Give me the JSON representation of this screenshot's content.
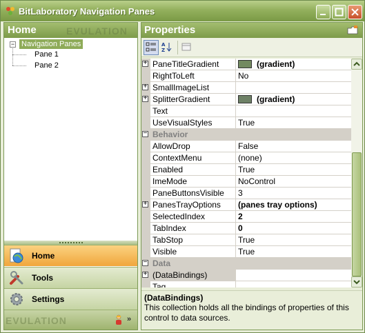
{
  "window": {
    "title": "BitLaboratory Navigation Panes",
    "controls": [
      "minimize",
      "maximize",
      "close"
    ]
  },
  "left_panel": {
    "header_title": "Home",
    "watermark": "EVULATION",
    "tree": {
      "root": "Navigation Panes",
      "children": [
        "Pane 1",
        "Pane 2"
      ]
    },
    "panes": [
      {
        "label": "Home",
        "icon": "home-globe-icon",
        "active": true
      },
      {
        "label": "Tools",
        "icon": "tools-icon",
        "active": false
      },
      {
        "label": "Settings",
        "icon": "settings-gear-icon",
        "active": false
      }
    ],
    "tray": {
      "watermark": "EVULATION",
      "chevron": "»"
    }
  },
  "properties": {
    "header_title": "Properties",
    "rows": [
      {
        "type": "prop",
        "expander": "+",
        "name": "PaneTitleGradient",
        "value": "(gradient)",
        "bold": true,
        "swatch": "#738a60"
      },
      {
        "type": "prop",
        "expander": "",
        "name": "RightToLeft",
        "value": "No",
        "bold": false
      },
      {
        "type": "prop",
        "expander": "+",
        "name": "SmallImageList",
        "value": "",
        "bold": false
      },
      {
        "type": "prop",
        "expander": "+",
        "name": "SplitterGradient",
        "value": "(gradient)",
        "bold": true,
        "swatch": "#6e8166"
      },
      {
        "type": "prop",
        "expander": "",
        "name": "Text",
        "value": "",
        "bold": false
      },
      {
        "type": "prop",
        "expander": "",
        "name": "UseVisualStyles",
        "value": "True",
        "bold": false
      },
      {
        "type": "cat",
        "expander": "−",
        "name": "Behavior"
      },
      {
        "type": "prop",
        "expander": "",
        "name": "AllowDrop",
        "value": "False",
        "bold": false
      },
      {
        "type": "prop",
        "expander": "",
        "name": "ContextMenu",
        "value": "(none)",
        "bold": false
      },
      {
        "type": "prop",
        "expander": "",
        "name": "Enabled",
        "value": "True",
        "bold": false
      },
      {
        "type": "prop",
        "expander": "",
        "name": "ImeMode",
        "value": "NoControl",
        "bold": false
      },
      {
        "type": "prop",
        "expander": "",
        "name": "PaneButtonsVisible",
        "value": "3",
        "bold": false
      },
      {
        "type": "prop",
        "expander": "+",
        "name": "PanesTrayOptions",
        "value": "(panes tray options)",
        "bold": true
      },
      {
        "type": "prop",
        "expander": "",
        "name": "SelectedIndex",
        "value": "2",
        "bold": true
      },
      {
        "type": "prop",
        "expander": "",
        "name": "TabIndex",
        "value": "0",
        "bold": true
      },
      {
        "type": "prop",
        "expander": "",
        "name": "TabStop",
        "value": "True",
        "bold": false
      },
      {
        "type": "prop",
        "expander": "",
        "name": "Visible",
        "value": "True",
        "bold": false
      },
      {
        "type": "cat",
        "expander": "−",
        "name": "Data"
      },
      {
        "type": "prop",
        "expander": "+",
        "name": "(DataBindings)",
        "value": "",
        "bold": false,
        "selected": true
      },
      {
        "type": "prop",
        "expander": "",
        "name": "Tag",
        "value": "",
        "bold": false
      }
    ],
    "description": {
      "title": "(DataBindings)",
      "text": "This collection holds all the bindings of properties of this control to data sources."
    }
  }
}
